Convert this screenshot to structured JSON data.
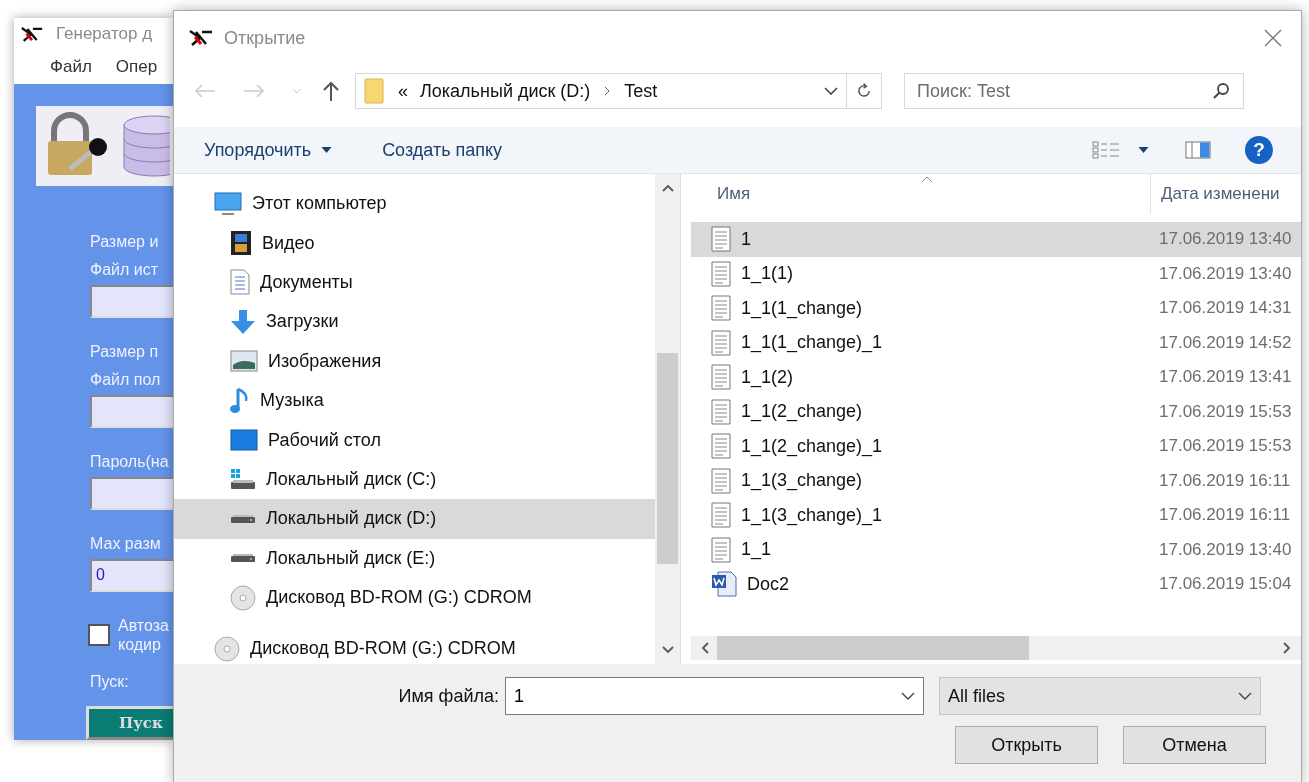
{
  "back_window": {
    "title": "Генератор д",
    "menu": [
      "Файл",
      "Опер"
    ],
    "form": [
      {
        "kind": "label",
        "text": "Размер и"
      },
      {
        "kind": "label",
        "text": "Файл ист"
      },
      {
        "kind": "field"
      },
      {
        "kind": "label",
        "text": "Размер п"
      },
      {
        "kind": "label",
        "text": "Файл пол"
      },
      {
        "kind": "field"
      },
      {
        "kind": "label",
        "text": "Пароль(на"
      },
      {
        "kind": "field"
      },
      {
        "kind": "label",
        "text": "Мах разм"
      },
      {
        "kind": "field",
        "value": "0"
      },
      {
        "kind": "checkbox",
        "text": "Автоза кодир",
        "checked": false
      },
      {
        "kind": "label",
        "text": "Пуск:"
      },
      {
        "kind": "button",
        "text": "Пуск"
      }
    ]
  },
  "dialog": {
    "title": "Открытие",
    "address": {
      "prefix": "«",
      "crumbs": [
        "Локальный диск (D:)",
        "Test"
      ]
    },
    "search": {
      "placeholder": "Поиск: Test"
    },
    "toolbar": [
      {
        "kind": "menu",
        "label": "Упорядочить"
      },
      {
        "kind": "button",
        "label": "Создать папку"
      }
    ],
    "help": "?",
    "nav": [
      {
        "label": "Этот компьютер",
        "kind": "computer",
        "selected": false,
        "children": [
          {
            "label": "Видео",
            "kind": "video",
            "selected": false
          },
          {
            "label": "Документы",
            "kind": "documents",
            "selected": false
          },
          {
            "label": "Загрузки",
            "kind": "downloads",
            "selected": false
          },
          {
            "label": "Изображения",
            "kind": "pictures",
            "selected": false
          },
          {
            "label": "Музыка",
            "kind": "music",
            "selected": false
          },
          {
            "label": "Рабочий стол",
            "kind": "desktop",
            "selected": false
          },
          {
            "label": "Локальный диск (C:)",
            "kind": "system-drive",
            "selected": false
          },
          {
            "label": "Локальный диск (D:)",
            "kind": "drive",
            "selected": true
          },
          {
            "label": "Локальный диск (E:)",
            "kind": "drive",
            "selected": false
          },
          {
            "label": "Дисковод BD-ROM (G:) CDROM",
            "kind": "disc",
            "selected": false
          }
        ]
      },
      {
        "label": "Дисковод BD-ROM (G:) CDROM",
        "kind": "disc",
        "selected": false
      }
    ],
    "columns": [
      "Имя",
      "Дата изменени"
    ],
    "files": [
      {
        "name": "1",
        "date": "17.06.2019 13:40",
        "kind": "text",
        "selected": true
      },
      {
        "name": "1_1(1)",
        "date": "17.06.2019 13:40",
        "kind": "text",
        "selected": false
      },
      {
        "name": "1_1(1_change)",
        "date": "17.06.2019 14:31",
        "kind": "text",
        "selected": false
      },
      {
        "name": "1_1(1_change)_1",
        "date": "17.06.2019 14:52",
        "kind": "text",
        "selected": false
      },
      {
        "name": "1_1(2)",
        "date": "17.06.2019 13:41",
        "kind": "text",
        "selected": false
      },
      {
        "name": "1_1(2_change)",
        "date": "17.06.2019 15:53",
        "kind": "text",
        "selected": false
      },
      {
        "name": "1_1(2_change)_1",
        "date": "17.06.2019 15:53",
        "kind": "text",
        "selected": false
      },
      {
        "name": "1_1(3_change)",
        "date": "17.06.2019 16:11",
        "kind": "text",
        "selected": false
      },
      {
        "name": "1_1(3_change)_1",
        "date": "17.06.2019 16:11",
        "kind": "text",
        "selected": false
      },
      {
        "name": "1_1",
        "date": "17.06.2019 13:40",
        "kind": "text",
        "selected": false
      },
      {
        "name": "Doc2",
        "date": "17.06.2019 15:04",
        "kind": "word",
        "selected": false
      }
    ],
    "filename": {
      "label": "Имя файла:",
      "value": "1"
    },
    "filter": {
      "value": "All files"
    },
    "buttons": [
      "Открыть",
      "Отмена"
    ]
  }
}
